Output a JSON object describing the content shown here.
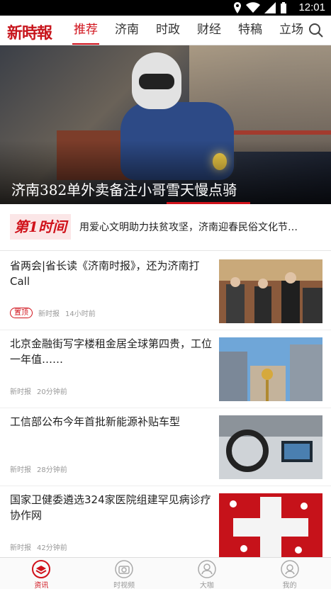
{
  "status_bar": {
    "time": "12:01"
  },
  "header": {
    "logo_text": "新時報",
    "tabs": [
      {
        "label": "推荐",
        "active": true
      },
      {
        "label": "济南",
        "active": false
      },
      {
        "label": "时政",
        "active": false
      },
      {
        "label": "财经",
        "active": false
      },
      {
        "label": "特稿",
        "active": false
      },
      {
        "label": "立场",
        "active": false
      }
    ],
    "search_icon": "search-icon"
  },
  "hero": {
    "caption": "济南382单外卖备注小哥雪天慢点骑"
  },
  "first_time": {
    "badge_text": "第1时间",
    "headline": "用爱心文明助力扶贫攻坚，济南迎春民俗文化节…"
  },
  "news": [
    {
      "title": "省两会|省长读《济南时报》，还为济南打Call",
      "tag": "置顶",
      "source": "新时报",
      "time": "14小时前"
    },
    {
      "title": "北京金融街写字楼租金居全球第四贵，工位一年值……",
      "tag": "",
      "source": "新时报",
      "time": "20分钟前"
    },
    {
      "title": "工信部公布今年首批新能源补贴车型",
      "tag": "",
      "source": "新时报",
      "time": "28分钟前"
    },
    {
      "title": "国家卫健委遴选324家医院组建罕见病诊疗协作网",
      "tag": "",
      "source": "新时报",
      "time": "42分钟前"
    }
  ],
  "tabbar": [
    {
      "label": "资讯",
      "icon": "news-icon",
      "active": true
    },
    {
      "label": "时视频",
      "icon": "camera-icon",
      "active": false
    },
    {
      "label": "大咖",
      "icon": "user-icon",
      "active": false
    },
    {
      "label": "我的",
      "icon": "profile-icon",
      "active": false
    }
  ],
  "colors": {
    "accent": "#d0121b"
  }
}
